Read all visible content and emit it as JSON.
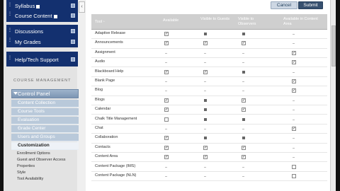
{
  "nav": {
    "items": [
      {
        "label": "Syllabus"
      },
      {
        "label": "Course Content"
      },
      {
        "label": "Discussions"
      },
      {
        "label": "My Grades"
      },
      {
        "label": "Help/Tech Support"
      }
    ],
    "section_label": "COURSE MANAGEMENT",
    "control_panel": "Control Panel",
    "control_items": [
      {
        "label": "Content Collection"
      },
      {
        "label": "Course Tools"
      },
      {
        "label": "Evaluation"
      },
      {
        "label": "Grade Center"
      },
      {
        "label": "Users and Groups"
      },
      {
        "label": "Customization"
      }
    ],
    "customization_items": [
      {
        "label": "Enrollment Options"
      },
      {
        "label": "Guest and Observer Access"
      },
      {
        "label": "Properties"
      },
      {
        "label": "Style"
      },
      {
        "label": "Tool Availability"
      }
    ]
  },
  "toolbar": {
    "cancel_label": "Cancel",
    "submit_label": "Submit"
  },
  "table": {
    "headers": {
      "tool": "Tool",
      "available": "Available",
      "guests": "Visible to Guests",
      "observers": "Visible to Observers",
      "content_area": "Available in Content Area"
    },
    "rows": [
      {
        "name": "Adaptive Release",
        "available": "check",
        "guests": "mark",
        "observers": "mark",
        "content": "dash"
      },
      {
        "name": "Announcements",
        "available": "check",
        "guests": "check",
        "observers": "check",
        "content": "dash"
      },
      {
        "name": "Assignment",
        "available": "dash",
        "guests": "dash",
        "observers": "dash",
        "content": "check"
      },
      {
        "name": "Audio",
        "available": "dash",
        "guests": "dash",
        "observers": "dash",
        "content": "check"
      },
      {
        "name": "Blackboard Help",
        "available": "check",
        "guests": "check",
        "observers": "mark",
        "content": "dash"
      },
      {
        "name": "Blank Page",
        "available": "dash",
        "guests": "dash",
        "observers": "dash",
        "content": "check"
      },
      {
        "name": "Blog",
        "available": "dash",
        "guests": "dash",
        "observers": "dash",
        "content": "check"
      },
      {
        "name": "Blogs",
        "available": "check",
        "guests": "mark",
        "observers": "check",
        "content": "dash"
      },
      {
        "name": "Calendar",
        "available": "check",
        "guests": "mark",
        "observers": "check",
        "content": "dash"
      },
      {
        "name": "Chalk Title Management",
        "available": "empty",
        "guests": "mark",
        "observers": "mark",
        "content": "dash"
      },
      {
        "name": "Chat",
        "available": "dash",
        "guests": "dash",
        "observers": "dash",
        "content": "check"
      },
      {
        "name": "Collaboration",
        "available": "check",
        "guests": "mark",
        "observers": "mark",
        "content": "dash"
      },
      {
        "name": "Contacts",
        "available": "check",
        "guests": "check",
        "observers": "check",
        "content": "dash"
      },
      {
        "name": "Content Area",
        "available": "check",
        "guests": "check",
        "observers": "check",
        "content": "dash"
      },
      {
        "name": "Content Package (IMS)",
        "available": "dash",
        "guests": "dash",
        "observers": "dash",
        "content": "empty"
      },
      {
        "name": "Content Package (NLN)",
        "available": "dash",
        "guests": "dash",
        "observers": "dash",
        "content": "empty"
      }
    ]
  }
}
